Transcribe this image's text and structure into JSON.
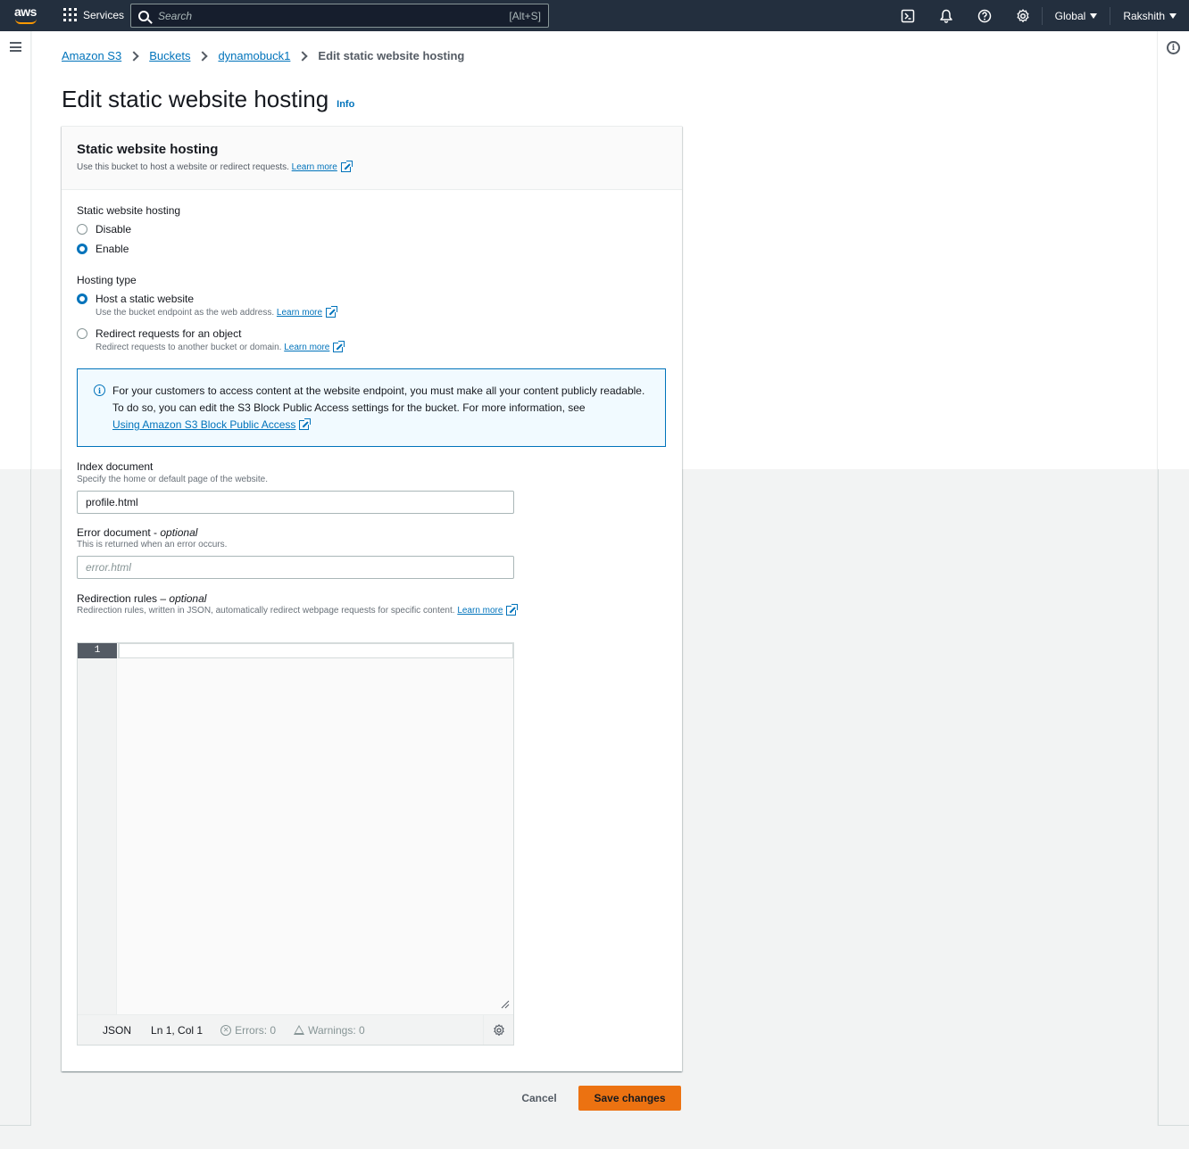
{
  "topnav": {
    "logo_text": "aws",
    "services_label": "Services",
    "search_placeholder": "Search",
    "search_shortcut": "[Alt+S]",
    "region_label": "Global",
    "user_label": "Rakshith",
    "icons": [
      "cloudshell-icon",
      "bell-icon",
      "help-icon",
      "gear-icon"
    ]
  },
  "breadcrumb": {
    "items": [
      "Amazon S3",
      "Buckets",
      "dynamobuck1"
    ],
    "current": "Edit static website hosting"
  },
  "page": {
    "title": "Edit static website hosting",
    "info_label": "Info"
  },
  "card": {
    "title": "Static website hosting",
    "description": "Use this bucket to host a website or redirect requests.",
    "learn_more": "Learn more"
  },
  "hosting_toggle": {
    "label": "Static website hosting",
    "options": [
      "Disable",
      "Enable"
    ],
    "selected": "Enable"
  },
  "hosting_type": {
    "label": "Hosting type",
    "options": [
      {
        "label": "Host a static website",
        "description": "Use the bucket endpoint as the web address.",
        "link": "Learn more"
      },
      {
        "label": "Redirect requests for an object",
        "description": "Redirect requests to another bucket or domain.",
        "link": "Learn more"
      }
    ],
    "selected": "Host a static website"
  },
  "alert": {
    "text": "For your customers to access content at the website endpoint, you must make all your content publicly readable. To do so, you can edit the S3 Block Public Access settings for the bucket. For more information, see",
    "link": "Using Amazon S3 Block Public Access"
  },
  "index_document": {
    "label": "Index document",
    "description": "Specify the home or default page of the website.",
    "value": "profile.html"
  },
  "error_document": {
    "label": "Error document - ",
    "label_optional": "optional",
    "description": "This is returned when an error occurs.",
    "placeholder": "error.html",
    "value": ""
  },
  "redirection_rules": {
    "label": "Redirection rules – ",
    "label_optional": "optional",
    "description": "Redirection rules, written in JSON, automatically redirect webpage requests for specific content.",
    "learn_more": "Learn more"
  },
  "editor": {
    "line_number": "1",
    "language": "JSON",
    "position": "Ln 1, Col 1",
    "errors": "Errors: 0",
    "warnings": "Warnings: 0"
  },
  "footer": {
    "cancel_label": "Cancel",
    "save_label": "Save changes"
  },
  "colors": {
    "nav_bg": "#232f3e",
    "link": "#0073bb",
    "primary_button": "#ec7211",
    "aws_orange": "#ff9900"
  }
}
